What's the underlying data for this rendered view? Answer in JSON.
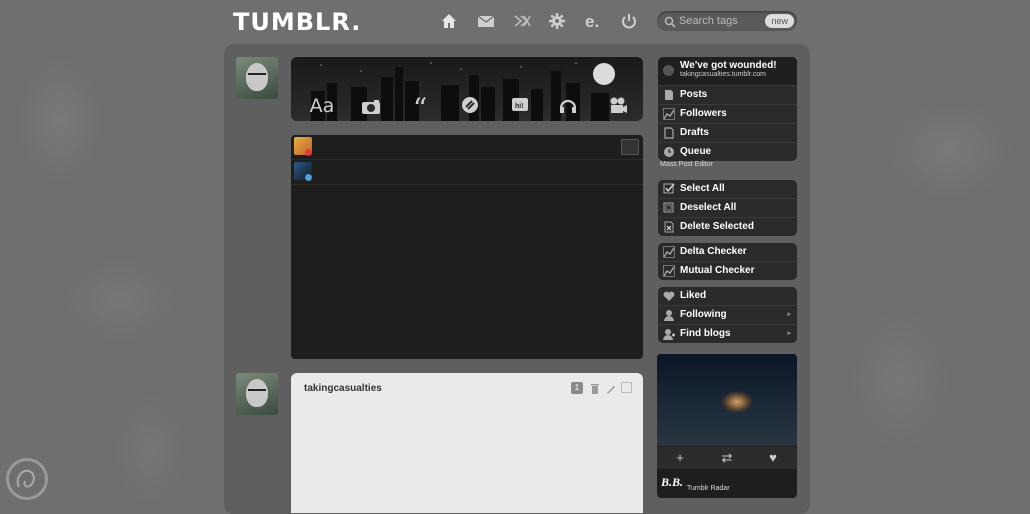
{
  "header": {
    "logo": "TUMBLR.",
    "nav": [
      {
        "name": "home-icon"
      },
      {
        "name": "mail-icon"
      },
      {
        "name": "xkit-icon"
      },
      {
        "name": "gear-icon"
      },
      {
        "name": "e-icon"
      },
      {
        "name": "power-icon"
      }
    ],
    "search": {
      "placeholder": "Search tags",
      "badge": "new"
    }
  },
  "post_types": [
    {
      "name": "text-post-button",
      "glyph": "Aa"
    },
    {
      "name": "photo-post-button",
      "glyph": "camera"
    },
    {
      "name": "quote-post-button",
      "glyph": "“"
    },
    {
      "name": "link-post-button",
      "glyph": "link"
    },
    {
      "name": "chat-post-button",
      "glyph": "hi!"
    },
    {
      "name": "audio-post-button",
      "glyph": "headphones"
    },
    {
      "name": "video-post-button",
      "glyph": "video"
    }
  ],
  "post": {
    "username": "takingcasualties"
  },
  "sidebar": {
    "blog": {
      "title": "We've got wounded!",
      "url": "takingcasualties.tumblr.com"
    },
    "blog_menu": [
      {
        "label": "Posts",
        "icon": "page-icon"
      },
      {
        "label": "Followers",
        "icon": "chart-icon"
      },
      {
        "label": "Drafts",
        "icon": "page-icon"
      },
      {
        "label": "Queue",
        "icon": "clock-icon"
      }
    ],
    "mass_editor_label": "Mass Post Editor",
    "mass_menu": [
      {
        "label": "Select All",
        "icon": "checkbox-icon"
      },
      {
        "label": "Deselect All",
        "icon": "checkbox-icon"
      },
      {
        "label": "Delete Selected",
        "icon": "delete-icon"
      }
    ],
    "checker_menu": [
      {
        "label": "Delta Checker",
        "icon": "chart-icon"
      },
      {
        "label": "Mutual Checker",
        "icon": "chart-icon"
      }
    ],
    "account_menu": [
      {
        "label": "Liked",
        "icon": "heart-icon",
        "arrow": false
      },
      {
        "label": "Following",
        "icon": "person-icon",
        "arrow": true
      },
      {
        "label": "Find blogs",
        "icon": "add-person-icon",
        "arrow": true
      }
    ],
    "radar": {
      "blog_name": "B.B.",
      "label": "Tumblr Radar"
    }
  },
  "colors": {
    "accent": "#2a2a2a",
    "background": "#6f6f6f"
  }
}
